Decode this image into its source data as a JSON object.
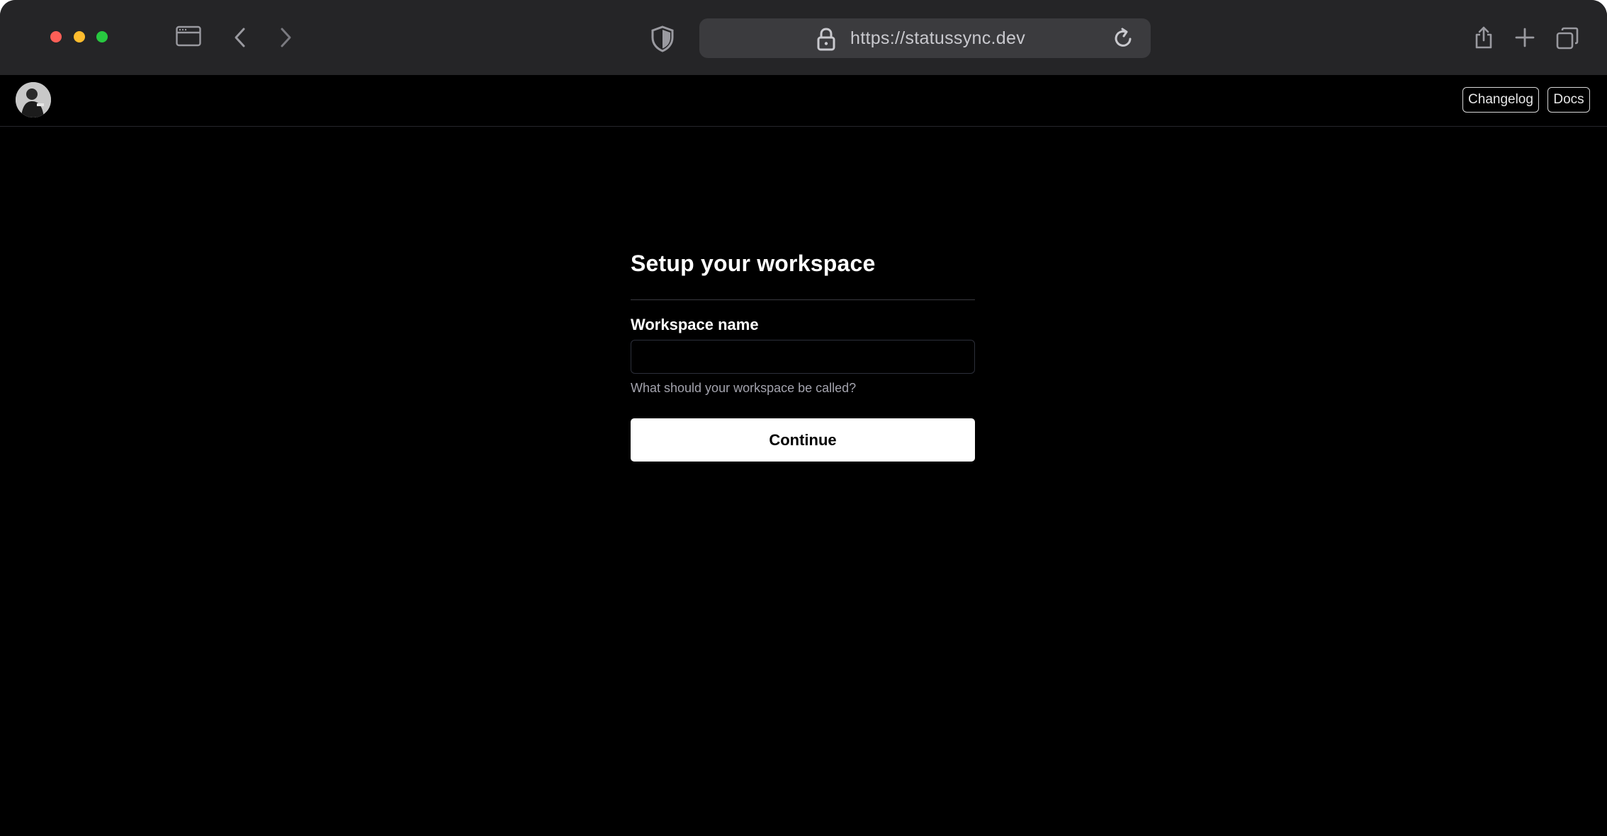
{
  "browser": {
    "url": "https://statussync.dev",
    "icons": [
      "sidebar-icon",
      "back-chevron-icon",
      "forward-chevron-icon",
      "shield-icon",
      "lock-icon",
      "reload-icon",
      "share-icon",
      "new-tab-icon",
      "tabs-overview-icon"
    ]
  },
  "header": {
    "changelog_label": "Changelog",
    "docs_label": "Docs"
  },
  "form": {
    "title": "Setup your workspace",
    "field_label": "Workspace name",
    "field_value": "",
    "field_hint": "What should your workspace be called?",
    "submit_label": "Continue"
  },
  "colors": {
    "chrome_bg": "#252527",
    "page_bg": "#000000",
    "close": "#fe5f57",
    "minimize": "#febc2e",
    "maximize": "#28c840",
    "primary_button_bg": "#ffffff"
  }
}
